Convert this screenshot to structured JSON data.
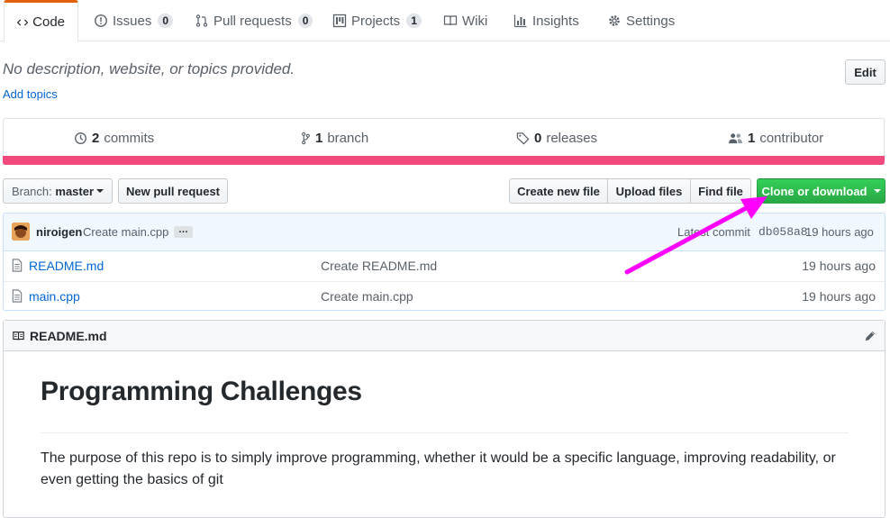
{
  "tabs": [
    {
      "label": "Code",
      "icon": "code-icon",
      "selected": true
    },
    {
      "label": "Issues",
      "icon": "issue-icon",
      "count": "0"
    },
    {
      "label": "Pull requests",
      "icon": "pull-request-icon",
      "count": "0"
    },
    {
      "label": "Projects",
      "icon": "project-icon",
      "count": "1"
    },
    {
      "label": "Wiki",
      "icon": "book-icon"
    },
    {
      "label": "Insights",
      "icon": "graph-icon"
    },
    {
      "label": "Settings",
      "icon": "gear-icon"
    }
  ],
  "repo": {
    "description": "No description, website, or topics provided.",
    "add_topics": "Add topics",
    "edit_label": "Edit"
  },
  "summary": {
    "commits_count": "2",
    "commits_label": "commits",
    "branch_count": "1",
    "branch_label": "branch",
    "releases_count": "0",
    "releases_label": "releases",
    "contributor_count": "1",
    "contributor_label": "contributor",
    "language_color": "#f34b7d"
  },
  "filenav": {
    "branch_prefix": "Branch:",
    "branch_name": "master",
    "new_pull_request": "New pull request",
    "create_new_file": "Create new file",
    "upload_files": "Upload files",
    "find_file": "Find file",
    "clone_or_download": "Clone or download"
  },
  "commit": {
    "author": "niroigen",
    "message": "Create main.cpp",
    "ellipsis": "…",
    "latest_label": "Latest commit",
    "sha": "db058a8",
    "age": "19 hours ago"
  },
  "files": [
    {
      "name": "README.md",
      "message": "Create README.md",
      "age": "19 hours ago"
    },
    {
      "name": "main.cpp",
      "message": "Create main.cpp",
      "age": "19 hours ago"
    }
  ],
  "readme": {
    "filename": "README.md",
    "heading": "Programming Challenges",
    "body": "The purpose of this repo is to simply improve programming, whether it would be a specific language, improving readability, or even getting the basics of git"
  },
  "colors": {
    "accent": "#0366d6",
    "clone_green": "#28a745",
    "annotation_arrow": "#ff00ff"
  }
}
